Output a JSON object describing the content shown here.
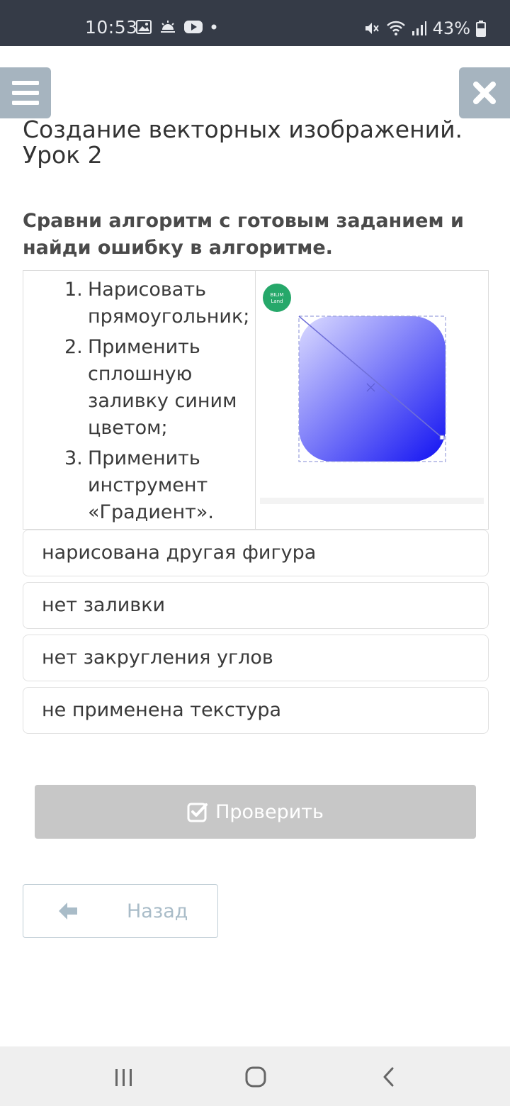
{
  "status": {
    "time": "10:53",
    "battery": "43%",
    "icons_left": [
      "gallery-icon",
      "weather-icon",
      "youtube-icon",
      "dot-icon"
    ],
    "icons_right": [
      "mute-icon",
      "wifi-icon",
      "signal-icon",
      "battery-icon"
    ]
  },
  "header": {
    "menu_icon": "hamburger-icon",
    "close_icon": "close-icon",
    "title": "Создание векторных изображений. Урок 2"
  },
  "question": "Сравни алгоритм с готовым заданием и найди ошибку в алгоритме.",
  "steps": [
    {
      "num": "1.",
      "text": "Нарисовать прямоугольник;"
    },
    {
      "num": "2.",
      "text": "Применить сплошную заливку синим цветом;"
    },
    {
      "num": "3.",
      "text": "Применить инструмент «Градиент»."
    }
  ],
  "image": {
    "logo_lines": [
      "BILIM",
      "Land"
    ],
    "gradient_from": "#dcdcff",
    "gradient_to": "#1111f2"
  },
  "options": [
    "нарисована другая фигура",
    "нет заливки",
    "нет закругления углов",
    "не применена текстура"
  ],
  "check_button": {
    "label": "Проверить",
    "icon": "check-square-icon"
  },
  "back_button": {
    "label": "Назад",
    "icon": "arrow-left-icon"
  },
  "nav": [
    "recents-icon",
    "home-icon",
    "back-icon"
  ]
}
